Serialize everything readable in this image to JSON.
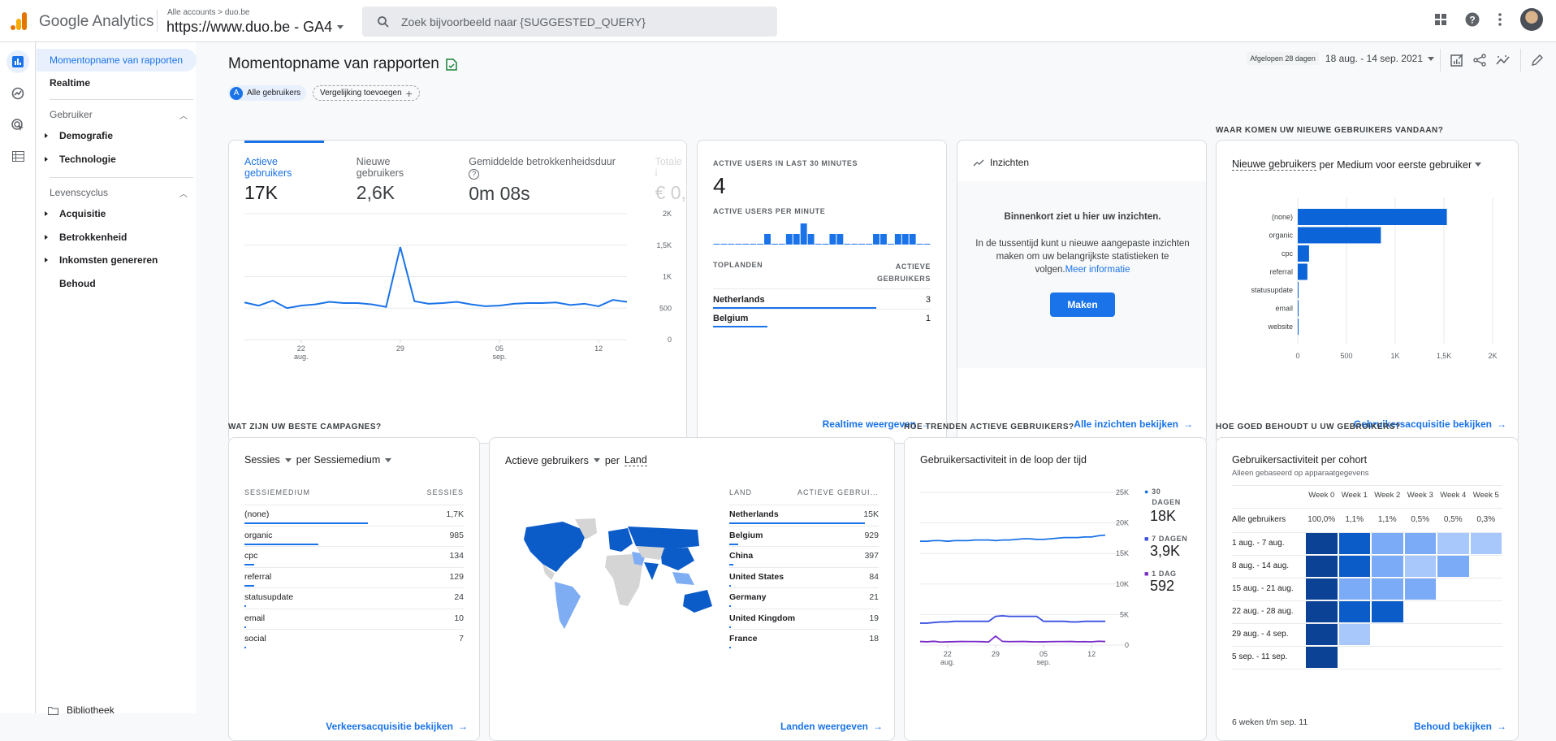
{
  "topbar": {
    "app_name": "Google Analytics",
    "breadcrumb": "Alle accounts > duo.be",
    "property": "https://www.duo.be - GA4",
    "search_placeholder": "Zoek bijvoorbeeld naar {SUGGESTED_QUERY}",
    "icons": [
      "apps-grid-icon",
      "help-icon",
      "more-vert-icon",
      "account-avatar"
    ]
  },
  "rail": {
    "icons": [
      "reports-icon",
      "explore-icon",
      "advertising-icon",
      "configure-icon"
    ]
  },
  "sidebar": {
    "snapshot": "Momentopname van rapporten",
    "realtime": "Realtime",
    "group1": "Gebruiker",
    "g1_items": [
      "Demografie",
      "Technologie"
    ],
    "group2": "Levenscyclus",
    "g2_items": [
      "Acquisitie",
      "Betrokkenheid",
      "Inkomsten genereren"
    ],
    "behoud": "Behoud",
    "library": "Bibliotheek"
  },
  "page": {
    "title": "Momentopname van rapporten",
    "segment_letter": "A",
    "segment": "Alle gebruikers",
    "add_comparison": "Vergelijking toevoegen",
    "date_label": "Afgelopen 28 dagen",
    "date_range": "18 aug. - 14 sep. 2021"
  },
  "overview": {
    "tabs": [
      {
        "label": "Actieve gebruikers",
        "value": "17K"
      },
      {
        "label": "Nieuwe gebruikers",
        "value": "2,6K"
      },
      {
        "label": "Gemiddelde betrokkenheidsduur",
        "value": "0m 08s"
      },
      {
        "label": "Totale i",
        "value": "€ 0,"
      }
    ],
    "yticks": [
      "2K",
      "1,5K",
      "1K",
      "500",
      "0"
    ],
    "xticks": [
      {
        "d": "22",
        "m": "aug."
      },
      {
        "d": "29",
        "m": ""
      },
      {
        "d": "05",
        "m": "sep."
      },
      {
        "d": "12",
        "m": ""
      }
    ]
  },
  "realtime": {
    "title": "ACTIVE USERS IN LAST 30 MINUTES",
    "value": "4",
    "per_minute": "ACTIVE USERS PER MINUTE",
    "col1": "TOPLANDEN",
    "col2a": "ACTIEVE",
    "col2b": "GEBRUIKERS",
    "rows": [
      {
        "name": "Netherlands",
        "value": "3"
      },
      {
        "name": "Belgium",
        "value": "1"
      }
    ],
    "link": "Realtime weergeven"
  },
  "insights": {
    "title": "Inzichten",
    "heading": "Binnenkort ziet u hier uw inzichten.",
    "body": "In de tussentijd kunt u nieuwe aangepaste inzichten maken om uw belangrijkste statistieken te volgen.",
    "more": "Meer informatie",
    "button": "Maken",
    "link": "Alle inzichten bekijken"
  },
  "newusers": {
    "section": "WAAR KOMEN UW NIEUWE GEBRUIKERS VANDAAN?",
    "metric": "Nieuwe gebruikers",
    "dimension": "per Medium voor eerste gebruiker",
    "link": "Gebruikersacquisitie bekijken"
  },
  "campaigns": {
    "section": "WAT ZIJN UW BESTE CAMPAGNES?",
    "metric": "Sessies",
    "dimension": "per Sessiemedium",
    "col1": "SESSIEMEDIUM",
    "col2": "SESSIES",
    "rows": [
      {
        "name": "(none)",
        "value": "1,7K",
        "frac": 0.56
      },
      {
        "name": "organic",
        "value": "985",
        "frac": 0.335
      },
      {
        "name": "cpc",
        "value": "134",
        "frac": 0.045
      },
      {
        "name": "referral",
        "value": "129",
        "frac": 0.043
      },
      {
        "name": "statusupdate",
        "value": "24",
        "frac": 0.008
      },
      {
        "name": "email",
        "value": "10",
        "frac": 0.003
      },
      {
        "name": "social",
        "value": "7",
        "frac": 0.002
      }
    ],
    "link": "Verkeersacquisitie bekijken"
  },
  "countries": {
    "metric": "Actieve gebruikers",
    "per": "per",
    "dimension": "Land",
    "col1": "LAND",
    "col2": "ACTIEVE GEBRUI...",
    "rows": [
      {
        "name": "Netherlands",
        "value": "15K",
        "frac": 0.9
      },
      {
        "name": "Belgium",
        "value": "929",
        "frac": 0.06
      },
      {
        "name": "China",
        "value": "397",
        "frac": 0.026
      },
      {
        "name": "United States",
        "value": "84",
        "frac": 0.006
      },
      {
        "name": "Germany",
        "value": "21",
        "frac": 0.002
      },
      {
        "name": "United Kingdom",
        "value": "19",
        "frac": 0.002
      },
      {
        "name": "France",
        "value": "18",
        "frac": 0.002
      }
    ],
    "link": "Landen weergeven"
  },
  "trend": {
    "section": "HOE TRENDEN ACTIEVE GEBRUIKERS?",
    "title": "Gebruikersactiviteit in de loop der tijd",
    "legend": [
      {
        "label1": "30",
        "label2": "DAGEN",
        "value": "18K",
        "color": "#1a73e8"
      },
      {
        "label1": "7 DAGEN",
        "label2": "",
        "value": "3,9K",
        "color": "#3a4fe0"
      },
      {
        "label1": "1 DAG",
        "label2": "",
        "value": "592",
        "color": "#7b2fc9"
      }
    ],
    "link": null
  },
  "cohort": {
    "section": "HOE GOED BEHOUDT U UW GEBRUIKERS?",
    "title": "Gebruikersactiviteit per cohort",
    "subtitle": "Alleen gebaseerd op apparaatgegevens",
    "weeks": [
      "Week 0",
      "Week 1",
      "Week 2",
      "Week 3",
      "Week 4",
      "Week 5"
    ],
    "all_label": "Alle gebruikers",
    "all_values": [
      "100,0%",
      "1,1%",
      "1,1%",
      "0,5%",
      "0,5%",
      "0,3%"
    ],
    "rows": [
      {
        "label": "1 aug. - 7 aug.",
        "levels": [
          4,
          3,
          2,
          2,
          1,
          1
        ]
      },
      {
        "label": "8 aug. - 14 aug.",
        "levels": [
          4,
          3,
          2,
          1,
          2
        ]
      },
      {
        "label": "15 aug. - 21 aug.",
        "levels": [
          4,
          2,
          2,
          2
        ]
      },
      {
        "label": "22 aug. - 28 aug.",
        "levels": [
          4,
          3,
          3
        ]
      },
      {
        "label": "29 aug. - 4 sep.",
        "levels": [
          4,
          1
        ]
      },
      {
        "label": "5 sep. - 11 sep.",
        "levels": [
          4
        ]
      }
    ],
    "footer": "6 weken t/m sep. 11",
    "link": "Behoud bekijken"
  },
  "chart_data": [
    {
      "type": "line",
      "title": "Actieve gebruikers",
      "x": [
        "18 aug",
        "19 aug",
        "20 aug",
        "21 aug",
        "22 aug",
        "23 aug",
        "24 aug",
        "25 aug",
        "26 aug",
        "27 aug",
        "28 aug",
        "29 aug",
        "30 aug",
        "31 aug",
        "1 sep",
        "2 sep",
        "3 sep",
        "4 sep",
        "5 sep",
        "6 sep",
        "7 sep",
        "8 sep",
        "9 sep",
        "10 sep",
        "11 sep",
        "12 sep",
        "13 sep",
        "14 sep"
      ],
      "series": [
        {
          "name": "Actieve gebruikers",
          "values": [
            590,
            540,
            620,
            500,
            540,
            560,
            600,
            580,
            580,
            560,
            520,
            1470,
            610,
            570,
            580,
            600,
            560,
            530,
            540,
            570,
            580,
            580,
            590,
            550,
            570,
            530,
            630,
            600
          ]
        }
      ],
      "ylim": [
        0,
        2000
      ],
      "yticks": [
        "0",
        "500",
        "1K",
        "1,5K",
        "2K"
      ]
    },
    {
      "type": "bar",
      "title": "Active users per minute",
      "categories": [
        "-30",
        "-29",
        "-28",
        "-27",
        "-26",
        "-25",
        "-24",
        "-23",
        "-22",
        "-21",
        "-20",
        "-19",
        "-18",
        "-17",
        "-16",
        "-15",
        "-14",
        "-13",
        "-12",
        "-11",
        "-10",
        "-9",
        "-8",
        "-7",
        "-6",
        "-5",
        "-4",
        "-3",
        "-2",
        "-1"
      ],
      "values": [
        0,
        0,
        0,
        0,
        0,
        0,
        0,
        1,
        0,
        0,
        1,
        1,
        2,
        1,
        0,
        0,
        1,
        1,
        0,
        0,
        0,
        0,
        1,
        1,
        0,
        1,
        1,
        1,
        0,
        0
      ]
    },
    {
      "type": "bar",
      "orientation": "horizontal",
      "title": "Nieuwe gebruikers per Medium voor eerste gebruiker",
      "categories": [
        "(none)",
        "organic",
        "cpc",
        "referral",
        "statusupdate",
        "email",
        "website"
      ],
      "values": [
        1530,
        853,
        116,
        99,
        6,
        1,
        1
      ],
      "xlim": [
        0,
        2000
      ],
      "xticks": [
        "0",
        "500",
        "1K",
        "1,5K",
        "2K"
      ]
    },
    {
      "type": "line",
      "title": "Gebruikersactiviteit in de loop der tijd",
      "x": [
        "18 aug",
        "19 aug",
        "20 aug",
        "21 aug",
        "22 aug",
        "23 aug",
        "24 aug",
        "25 aug",
        "26 aug",
        "27 aug",
        "28 aug",
        "29 aug",
        "30 aug",
        "31 aug",
        "1 sep",
        "2 sep",
        "3 sep",
        "4 sep",
        "5 sep",
        "6 sep",
        "7 sep",
        "8 sep",
        "9 sep",
        "10 sep",
        "11 sep",
        "12 sep",
        "13 sep",
        "14 sep"
      ],
      "series": [
        {
          "name": "30 dagen",
          "values": [
            17000,
            17000,
            17100,
            17100,
            17000,
            17100,
            17100,
            17100,
            17200,
            17200,
            17200,
            17100,
            17200,
            17200,
            17300,
            17400,
            17400,
            17300,
            17300,
            17400,
            17500,
            17600,
            17600,
            17600,
            17700,
            17700,
            17900,
            18000
          ]
        },
        {
          "name": "7 dagen",
          "values": [
            3600,
            3600,
            3700,
            3800,
            3800,
            3900,
            3900,
            3900,
            3900,
            3900,
            3900,
            4700,
            4800,
            4700,
            4700,
            4700,
            4700,
            4700,
            3900,
            3900,
            3900,
            3900,
            3800,
            3800,
            3900,
            3900,
            3900,
            3900
          ]
        },
        {
          "name": "1 dag",
          "values": [
            590,
            540,
            620,
            500,
            540,
            560,
            600,
            580,
            580,
            560,
            520,
            1470,
            610,
            570,
            580,
            600,
            560,
            530,
            540,
            570,
            580,
            580,
            590,
            550,
            570,
            530,
            630,
            592
          ]
        }
      ],
      "ylim": [
        0,
        25000
      ],
      "yticks": [
        "0",
        "5K",
        "10K",
        "15K",
        "20K",
        "25K"
      ]
    },
    {
      "type": "heatmap",
      "title": "Gebruikersactiviteit per cohort",
      "columns": [
        "Week 0",
        "Week 1",
        "Week 2",
        "Week 3",
        "Week 4",
        "Week 5"
      ],
      "rows": [
        "1 aug. - 7 aug.",
        "8 aug. - 14 aug.",
        "15 aug. - 21 aug.",
        "22 aug. - 28 aug.",
        "29 aug. - 4 sep.",
        "5 sep. - 11 sep."
      ],
      "totals": [
        "100,0%",
        "1,1%",
        "1,1%",
        "0,5%",
        "0,5%",
        "0,3%"
      ]
    }
  ]
}
